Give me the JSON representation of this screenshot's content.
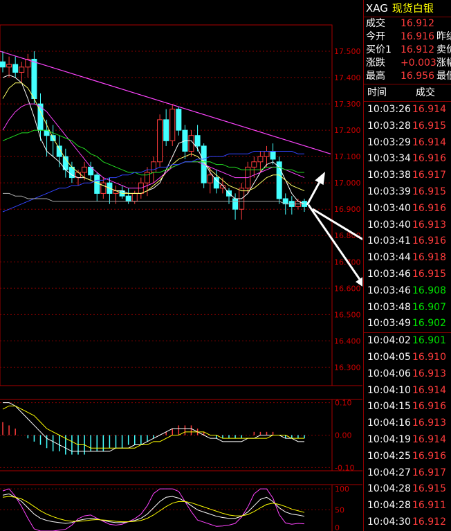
{
  "header": {
    "symbol": "XAG",
    "name": "现货白银"
  },
  "quote": [
    {
      "label": "成交",
      "value": "16.912",
      "extra": "",
      "color": "red"
    },
    {
      "label": "今开",
      "value": "16.916",
      "extra": "昨结",
      "color": "red"
    },
    {
      "label": "买价1",
      "value": "16.912",
      "extra": "卖价",
      "color": "red"
    },
    {
      "label": "涨跌",
      "value": "+0.003",
      "extra": "涨幅",
      "color": "red"
    },
    {
      "label": "最高",
      "value": "16.956",
      "extra": "最低",
      "color": "red"
    }
  ],
  "ticks_header": {
    "time": "时间",
    "price": "成交"
  },
  "ticks": [
    {
      "time": "10:03:26",
      "price": "16.914",
      "color": "red"
    },
    {
      "time": "10:03:28",
      "price": "16.915",
      "color": "red"
    },
    {
      "time": "10:03:29",
      "price": "16.914",
      "color": "red"
    },
    {
      "time": "10:03:34",
      "price": "16.916",
      "color": "red"
    },
    {
      "time": "10:03:38",
      "price": "16.917",
      "color": "red"
    },
    {
      "time": "10:03:39",
      "price": "16.915",
      "color": "red"
    },
    {
      "time": "10:03:40",
      "price": "16.916",
      "color": "red"
    },
    {
      "time": "10:03:40",
      "price": "16.913",
      "color": "red"
    },
    {
      "time": "10:03:41",
      "price": "16.916",
      "color": "red"
    },
    {
      "time": "10:03:44",
      "price": "16.918",
      "color": "red"
    },
    {
      "time": "10:03:46",
      "price": "16.915",
      "color": "red"
    },
    {
      "time": "10:03:46",
      "price": "16.908",
      "color": "green"
    },
    {
      "time": "10:03:48",
      "price": "16.907",
      "color": "green"
    },
    {
      "time": "10:03:49",
      "price": "16.902",
      "color": "green"
    },
    {
      "time": "10:04:02",
      "price": "16.901",
      "color": "green"
    },
    {
      "time": "10:04:05",
      "price": "16.910",
      "color": "red"
    },
    {
      "time": "10:04:06",
      "price": "16.913",
      "color": "red"
    },
    {
      "time": "10:04:10",
      "price": "16.914",
      "color": "red"
    },
    {
      "time": "10:04:15",
      "price": "16.916",
      "color": "red"
    },
    {
      "time": "10:04:16",
      "price": "16.913",
      "color": "red"
    },
    {
      "time": "10:04:19",
      "price": "16.914",
      "color": "red"
    },
    {
      "time": "10:04:25",
      "price": "16.916",
      "color": "red"
    },
    {
      "time": "10:04:27",
      "price": "16.917",
      "color": "red"
    },
    {
      "time": "10:04:28",
      "price": "16.915",
      "color": "red"
    },
    {
      "time": "10:04:28",
      "price": "16.911",
      "color": "red"
    },
    {
      "time": "10:04:30",
      "price": "16.912",
      "color": "red"
    }
  ],
  "chart_data": {
    "type": "candlestick",
    "price_axis": {
      "labels": [
        "17.500",
        "17.400",
        "17.300",
        "17.200",
        "17.100",
        "17.000",
        "16.900",
        "16.800",
        "16.700",
        "16.600",
        "16.500",
        "16.400",
        "16.300"
      ],
      "range": [
        16.23,
        17.6
      ]
    },
    "candles": [
      {
        "o": 17.46,
        "h": 17.5,
        "l": 17.42,
        "c": 17.44
      },
      {
        "o": 17.44,
        "h": 17.48,
        "l": 17.4,
        "c": 17.45
      },
      {
        "o": 17.45,
        "h": 17.48,
        "l": 17.4,
        "c": 17.42
      },
      {
        "o": 17.42,
        "h": 17.46,
        "l": 17.38,
        "c": 17.44
      },
      {
        "o": 17.44,
        "h": 17.49,
        "l": 17.4,
        "c": 17.47
      },
      {
        "o": 17.47,
        "h": 17.5,
        "l": 17.3,
        "c": 17.32
      },
      {
        "o": 17.3,
        "h": 17.34,
        "l": 17.16,
        "c": 17.2
      },
      {
        "o": 17.2,
        "h": 17.24,
        "l": 17.1,
        "c": 17.18
      },
      {
        "o": 17.18,
        "h": 17.22,
        "l": 17.1,
        "c": 17.16
      },
      {
        "o": 17.14,
        "h": 17.18,
        "l": 17.06,
        "c": 17.1
      },
      {
        "o": 17.1,
        "h": 17.13,
        "l": 17.02,
        "c": 17.05
      },
      {
        "o": 17.06,
        "h": 17.08,
        "l": 17.0,
        "c": 17.02
      },
      {
        "o": 17.02,
        "h": 17.05,
        "l": 16.99,
        "c": 17.04
      },
      {
        "o": 17.04,
        "h": 17.08,
        "l": 17.01,
        "c": 17.06
      },
      {
        "o": 17.06,
        "h": 17.08,
        "l": 17.01,
        "c": 17.03
      },
      {
        "o": 17.03,
        "h": 17.04,
        "l": 16.93,
        "c": 16.96
      },
      {
        "o": 16.96,
        "h": 17.02,
        "l": 16.94,
        "c": 17.0
      },
      {
        "o": 17.0,
        "h": 17.02,
        "l": 16.92,
        "c": 16.96
      },
      {
        "o": 16.96,
        "h": 16.99,
        "l": 16.92,
        "c": 16.97
      },
      {
        "o": 16.97,
        "h": 16.99,
        "l": 16.94,
        "c": 16.95
      },
      {
        "o": 16.95,
        "h": 16.98,
        "l": 16.92,
        "c": 16.93
      },
      {
        "o": 16.93,
        "h": 16.97,
        "l": 16.92,
        "c": 16.96
      },
      {
        "o": 16.96,
        "h": 17.02,
        "l": 16.94,
        "c": 17.0
      },
      {
        "o": 17.0,
        "h": 17.06,
        "l": 16.95,
        "c": 17.04
      },
      {
        "o": 17.04,
        "h": 17.1,
        "l": 17.0,
        "c": 17.08
      },
      {
        "o": 17.08,
        "h": 17.26,
        "l": 17.06,
        "c": 17.24
      },
      {
        "o": 17.24,
        "h": 17.28,
        "l": 17.14,
        "c": 17.16
      },
      {
        "o": 17.16,
        "h": 17.3,
        "l": 17.14,
        "c": 17.28
      },
      {
        "o": 17.28,
        "h": 17.29,
        "l": 17.18,
        "c": 17.2
      },
      {
        "o": 17.2,
        "h": 17.22,
        "l": 17.09,
        "c": 17.12
      },
      {
        "o": 17.12,
        "h": 17.2,
        "l": 17.1,
        "c": 17.18
      },
      {
        "o": 17.18,
        "h": 17.22,
        "l": 17.12,
        "c": 17.14
      },
      {
        "o": 17.14,
        "h": 17.15,
        "l": 16.98,
        "c": 17.0
      },
      {
        "o": 17.0,
        "h": 17.06,
        "l": 16.96,
        "c": 17.03
      },
      {
        "o": 17.02,
        "h": 17.05,
        "l": 16.96,
        "c": 16.98
      },
      {
        "o": 16.98,
        "h": 17.02,
        "l": 16.96,
        "c": 16.99
      },
      {
        "o": 16.97,
        "h": 16.98,
        "l": 16.92,
        "c": 16.95
      },
      {
        "o": 16.94,
        "h": 16.96,
        "l": 16.86,
        "c": 16.9
      },
      {
        "o": 16.9,
        "h": 17.0,
        "l": 16.86,
        "c": 16.98
      },
      {
        "o": 16.98,
        "h": 17.08,
        "l": 16.96,
        "c": 17.06
      },
      {
        "o": 17.06,
        "h": 17.1,
        "l": 17.02,
        "c": 17.08
      },
      {
        "o": 17.08,
        "h": 17.12,
        "l": 17.04,
        "c": 17.1
      },
      {
        "o": 17.1,
        "h": 17.14,
        "l": 17.06,
        "c": 17.12
      },
      {
        "o": 17.12,
        "h": 17.15,
        "l": 17.07,
        "c": 17.09
      },
      {
        "o": 17.08,
        "h": 17.1,
        "l": 16.92,
        "c": 16.94
      },
      {
        "o": 16.94,
        "h": 16.96,
        "l": 16.88,
        "c": 16.92
      },
      {
        "o": 16.93,
        "h": 16.95,
        "l": 16.88,
        "c": 16.91
      },
      {
        "o": 16.91,
        "h": 16.94,
        "l": 16.9,
        "c": 16.93
      },
      {
        "o": 16.93,
        "h": 16.94,
        "l": 16.89,
        "c": 16.91
      }
    ],
    "ma_lines": [
      {
        "color": "#ffffff",
        "values": [
          17.4,
          17.41,
          17.4,
          17.38,
          17.32,
          17.25,
          17.17,
          17.12,
          17.1,
          17.08,
          17.05,
          17.03,
          17.02,
          17.02,
          17.01,
          17.0,
          16.99,
          16.98,
          16.97,
          16.97,
          16.96,
          16.96,
          16.96,
          16.97,
          16.98,
          17.0,
          17.05,
          17.1,
          17.15,
          17.16,
          17.16,
          17.13,
          17.08,
          17.04,
          17.01,
          16.99,
          16.96,
          16.94,
          16.94,
          16.96,
          17.0,
          17.04,
          17.07,
          17.08,
          17.06,
          17.01,
          16.96,
          16.93,
          16.92
        ]
      },
      {
        "color": "#ffff66",
        "values": [
          17.32,
          17.36,
          17.38,
          17.38,
          17.36,
          17.32,
          17.27,
          17.22,
          17.17,
          17.13,
          17.09,
          17.06,
          17.04,
          17.02,
          17.01,
          17.0,
          16.99,
          16.98,
          16.97,
          16.96,
          16.96,
          16.96,
          16.96,
          16.97,
          16.99,
          17.01,
          17.04,
          17.07,
          17.09,
          17.1,
          17.11,
          17.1,
          17.08,
          17.05,
          17.03,
          17.01,
          16.99,
          16.98,
          16.97,
          16.97,
          16.98,
          17.0,
          17.02,
          17.03,
          17.03,
          17.01,
          16.99,
          16.98,
          16.97
        ]
      },
      {
        "color": "#ff44ff",
        "values": [
          17.2,
          17.24,
          17.27,
          17.29,
          17.3,
          17.3,
          17.29,
          17.27,
          17.24,
          17.21,
          17.18,
          17.15,
          17.12,
          17.09,
          17.06,
          17.04,
          17.02,
          17.01,
          17.0,
          16.99,
          16.98,
          16.98,
          16.98,
          16.99,
          17.0,
          17.02,
          17.04,
          17.06,
          17.07,
          17.08,
          17.08,
          17.08,
          17.07,
          17.06,
          17.05,
          17.04,
          17.03,
          17.02,
          17.02,
          17.02,
          17.03,
          17.04,
          17.05,
          17.06,
          17.06,
          17.05,
          17.04,
          17.03,
          17.02
        ]
      },
      {
        "color": "#22dd22",
        "values": [
          17.16,
          17.17,
          17.18,
          17.19,
          17.19,
          17.2,
          17.2,
          17.2,
          17.19,
          17.18,
          17.17,
          17.16,
          17.14,
          17.13,
          17.11,
          17.1,
          17.08,
          17.07,
          17.06,
          17.05,
          17.04,
          17.04,
          17.03,
          17.03,
          17.04,
          17.04,
          17.05,
          17.06,
          17.07,
          17.08,
          17.08,
          17.08,
          17.08,
          17.08,
          17.07,
          17.07,
          17.06,
          17.06,
          17.05,
          17.05,
          17.05,
          17.05,
          17.06,
          17.06,
          17.06,
          17.05,
          17.05,
          17.04,
          17.04
        ]
      },
      {
        "color": "#3344ff",
        "values": [
          16.89,
          16.9,
          16.91,
          16.92,
          16.93,
          16.94,
          16.95,
          16.96,
          16.97,
          16.98,
          16.98,
          16.99,
          16.99,
          17.0,
          17.0,
          17.01,
          17.01,
          17.02,
          17.02,
          17.03,
          17.03,
          17.04,
          17.04,
          17.05,
          17.05,
          17.06,
          17.06,
          17.07,
          17.07,
          17.08,
          17.08,
          17.09,
          17.09,
          17.1,
          17.1,
          17.1,
          17.11,
          17.11,
          17.11,
          17.11,
          17.12,
          17.12,
          17.12,
          17.12,
          17.12,
          17.12,
          17.12,
          17.11,
          17.11
        ]
      },
      {
        "color": "#aaaaaa",
        "values": [
          16.96,
          16.96,
          16.95,
          16.95,
          16.94,
          16.94,
          16.94,
          16.94,
          16.93,
          16.93,
          16.93,
          16.93,
          16.93,
          16.93,
          16.93,
          16.93,
          16.93,
          16.93,
          16.93,
          16.93,
          16.93,
          16.93,
          16.93,
          16.93,
          16.93,
          16.93,
          16.93,
          16.93,
          16.93,
          16.93,
          16.93,
          16.93,
          16.93,
          16.93,
          16.93,
          16.93,
          16.93,
          16.93,
          16.93,
          16.93,
          16.93,
          16.93,
          16.93,
          16.93,
          16.93,
          16.92,
          16.92,
          16.92,
          16.92
        ]
      }
    ],
    "macd": {
      "axis": [
        "0.10",
        "0.00",
        "-0.10"
      ],
      "range": [
        -0.11,
        0.11
      ],
      "hist": [
        0.04,
        0.03,
        0.02,
        0.0,
        -0.01,
        -0.02,
        -0.03,
        -0.04,
        -0.05,
        -0.05,
        -0.06,
        -0.06,
        -0.06,
        -0.06,
        -0.05,
        -0.05,
        -0.05,
        -0.04,
        -0.04,
        -0.04,
        -0.03,
        -0.03,
        -0.03,
        -0.02,
        -0.01,
        0.0,
        0.01,
        0.02,
        0.03,
        0.03,
        0.03,
        0.02,
        0.01,
        0.0,
        -0.01,
        -0.01,
        -0.01,
        -0.01,
        -0.01,
        0.0,
        0.01,
        0.01,
        0.01,
        0.01,
        0.0,
        -0.01,
        -0.01,
        -0.01,
        -0.01
      ],
      "dif": [
        0.1,
        0.1,
        0.09,
        0.07,
        0.05,
        0.03,
        0.01,
        -0.01,
        -0.02,
        -0.03,
        -0.04,
        -0.05,
        -0.05,
        -0.05,
        -0.05,
        -0.05,
        -0.05,
        -0.05,
        -0.04,
        -0.04,
        -0.04,
        -0.03,
        -0.03,
        -0.02,
        -0.01,
        0.0,
        0.01,
        0.02,
        0.02,
        0.02,
        0.02,
        0.01,
        0.0,
        -0.01,
        -0.01,
        -0.02,
        -0.02,
        -0.02,
        -0.02,
        -0.01,
        -0.01,
        0.0,
        0.0,
        0.0,
        0.0,
        -0.01,
        -0.01,
        -0.02,
        -0.02
      ],
      "dea": [
        0.08,
        0.09,
        0.09,
        0.08,
        0.07,
        0.06,
        0.04,
        0.02,
        0.01,
        0.0,
        -0.01,
        -0.02,
        -0.03,
        -0.03,
        -0.04,
        -0.04,
        -0.04,
        -0.04,
        -0.04,
        -0.04,
        -0.04,
        -0.04,
        -0.03,
        -0.03,
        -0.02,
        -0.02,
        -0.01,
        0.0,
        0.0,
        0.01,
        0.01,
        0.01,
        0.01,
        0.0,
        0.0,
        -0.01,
        -0.01,
        -0.01,
        -0.01,
        -0.01,
        -0.01,
        -0.01,
        -0.01,
        0.0,
        0.0,
        0.0,
        -0.01,
        -0.01,
        -0.01
      ]
    },
    "kdj": {
      "axis": [
        "100",
        "50",
        "0"
      ],
      "range": [
        0,
        110
      ],
      "k": [
        85,
        88,
        80,
        70,
        55,
        40,
        30,
        25,
        22,
        20,
        18,
        20,
        25,
        28,
        30,
        28,
        25,
        22,
        20,
        20,
        22,
        25,
        30,
        40,
        55,
        70,
        80,
        82,
        78,
        70,
        60,
        50,
        45,
        40,
        35,
        32,
        30,
        30,
        35,
        45,
        60,
        75,
        80,
        70,
        55,
        45,
        40,
        38,
        35
      ],
      "d": [
        80,
        82,
        80,
        76,
        68,
        58,
        48,
        40,
        34,
        29,
        25,
        23,
        23,
        24,
        26,
        27,
        26,
        25,
        23,
        22,
        22,
        23,
        25,
        30,
        38,
        48,
        58,
        66,
        70,
        70,
        67,
        62,
        57,
        52,
        47,
        42,
        38,
        36,
        36,
        39,
        46,
        55,
        63,
        66,
        63,
        58,
        52,
        48,
        44
      ],
      "j": [
        95,
        100,
        82,
        58,
        30,
        5,
        0,
        0,
        0,
        2,
        4,
        14,
        29,
        36,
        38,
        30,
        23,
        16,
        14,
        16,
        22,
        29,
        40,
        60,
        89,
        100,
        100,
        100,
        94,
        70,
        46,
        26,
        21,
        16,
        11,
        12,
        14,
        18,
        33,
        57,
        88,
        100,
        100,
        78,
        39,
        19,
        16,
        18,
        17
      ]
    }
  }
}
